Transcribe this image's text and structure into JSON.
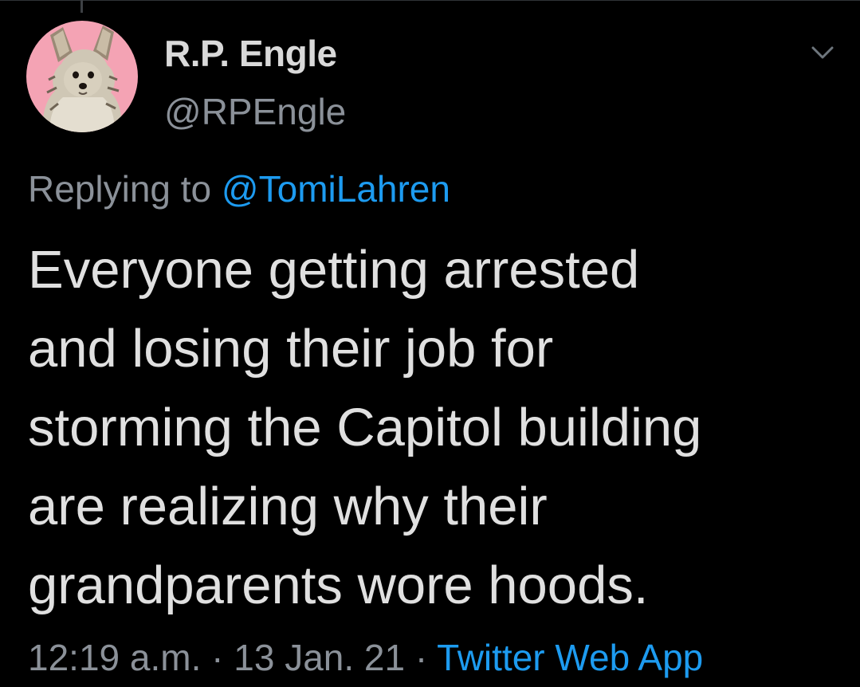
{
  "author": {
    "display_name": "R.P. Engle",
    "handle": "@RPEngle",
    "avatar_icon": "dog-avatar-icon"
  },
  "reply": {
    "prefix": "Replying to",
    "user": "@TomiLahren"
  },
  "tweet": {
    "lines": [
      "Everyone getting arrested",
      "and losing their job for",
      "storming the Capitol building",
      "are realizing why their",
      "grandparents wore hoods."
    ]
  },
  "meta": {
    "time": "12:19 a.m.",
    "separator": "·",
    "date": "13 Jan. 21",
    "source": "Twitter Web App"
  },
  "colors": {
    "background": "#000000",
    "text": "#e0e0e0",
    "secondary": "#8b9199",
    "link": "#1d9bf0",
    "avatar_bg": "#f4a3b4"
  }
}
